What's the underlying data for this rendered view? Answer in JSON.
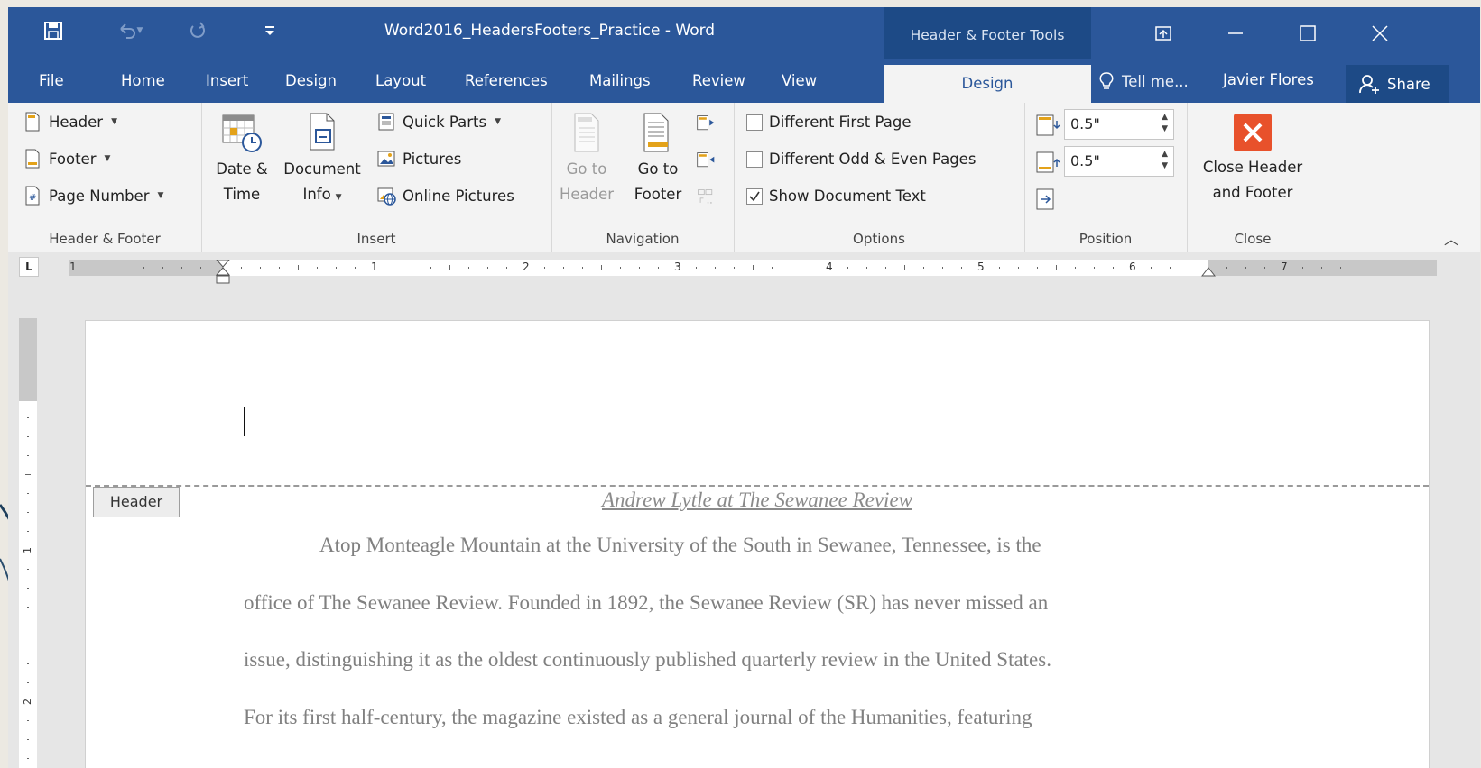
{
  "window": {
    "title": "Word2016_HeadersFooters_Practice - Word",
    "contextual_title": "Header & Footer Tools"
  },
  "tabs": [
    {
      "label": "File"
    },
    {
      "label": "Home"
    },
    {
      "label": "Insert"
    },
    {
      "label": "Design"
    },
    {
      "label": "Layout"
    },
    {
      "label": "References"
    },
    {
      "label": "Mailings"
    },
    {
      "label": "Review"
    },
    {
      "label": "View"
    },
    {
      "label": "Design",
      "active": true
    }
  ],
  "tellme": "Tell me...",
  "user": "Javier Flores",
  "share": "Share",
  "groups": {
    "header_footer": {
      "label": "Header & Footer",
      "header": "Header",
      "footer": "Footer",
      "page_number": "Page Number"
    },
    "insert": {
      "label": "Insert",
      "date_time_1": "Date &",
      "date_time_2": "Time",
      "doc_info_1": "Document",
      "doc_info_2": "Info",
      "quick_parts": "Quick Parts",
      "pictures": "Pictures",
      "online_pictures": "Online Pictures"
    },
    "navigation": {
      "label": "Navigation",
      "goto_header_1": "Go to",
      "goto_header_2": "Header",
      "goto_footer_1": "Go to",
      "goto_footer_2": "Footer"
    },
    "options": {
      "label": "Options",
      "different_first_page": "Different First Page",
      "different_odd_even": "Different Odd & Even Pages",
      "show_document_text": "Show Document Text",
      "different_first_page_checked": false,
      "different_odd_even_checked": false,
      "show_document_text_checked": true
    },
    "position": {
      "label": "Position",
      "header_from_top": "0.5\"",
      "footer_from_bottom": "0.5\""
    },
    "close": {
      "label": "Close",
      "close_1": "Close Header",
      "close_2": "and Footer"
    }
  },
  "ruler": {
    "tab_selector": "L",
    "numbers": [
      "1",
      "1",
      "2",
      "3",
      "4",
      "5",
      "6",
      "7"
    ]
  },
  "document": {
    "header_tag": "Header",
    "title": "Andrew Lytle at The Sewanee Review",
    "lines": [
      "Atop Monteagle Mountain at the University of the South in Sewanee, Tennessee, is the",
      "office of The Sewanee Review. Founded in 1892, the Sewanee Review (SR) has never missed an",
      "issue, distinguishing it as the oldest continuously published quarterly review in the United States.",
      "For its first half-century, the magazine existed as a general journal of the Humanities, featuring"
    ]
  },
  "colors": {
    "accent": "#2b579a",
    "accent_dark": "#1d4a86",
    "ribbon": "#f3f3f3",
    "close_red": "#e8512b"
  }
}
